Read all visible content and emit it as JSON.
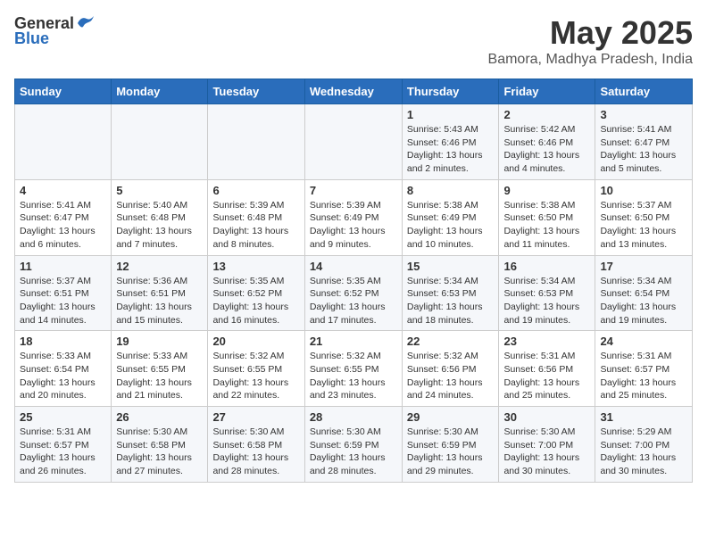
{
  "logo": {
    "general": "General",
    "blue": "Blue"
  },
  "header": {
    "title": "May 2025",
    "subtitle": "Bamora, Madhya Pradesh, India"
  },
  "weekdays": [
    "Sunday",
    "Monday",
    "Tuesday",
    "Wednesday",
    "Thursday",
    "Friday",
    "Saturday"
  ],
  "weeks": [
    [
      {
        "day": "",
        "info": ""
      },
      {
        "day": "",
        "info": ""
      },
      {
        "day": "",
        "info": ""
      },
      {
        "day": "",
        "info": ""
      },
      {
        "day": "1",
        "info": "Sunrise: 5:43 AM\nSunset: 6:46 PM\nDaylight: 13 hours\nand 2 minutes."
      },
      {
        "day": "2",
        "info": "Sunrise: 5:42 AM\nSunset: 6:46 PM\nDaylight: 13 hours\nand 4 minutes."
      },
      {
        "day": "3",
        "info": "Sunrise: 5:41 AM\nSunset: 6:47 PM\nDaylight: 13 hours\nand 5 minutes."
      }
    ],
    [
      {
        "day": "4",
        "info": "Sunrise: 5:41 AM\nSunset: 6:47 PM\nDaylight: 13 hours\nand 6 minutes."
      },
      {
        "day": "5",
        "info": "Sunrise: 5:40 AM\nSunset: 6:48 PM\nDaylight: 13 hours\nand 7 minutes."
      },
      {
        "day": "6",
        "info": "Sunrise: 5:39 AM\nSunset: 6:48 PM\nDaylight: 13 hours\nand 8 minutes."
      },
      {
        "day": "7",
        "info": "Sunrise: 5:39 AM\nSunset: 6:49 PM\nDaylight: 13 hours\nand 9 minutes."
      },
      {
        "day": "8",
        "info": "Sunrise: 5:38 AM\nSunset: 6:49 PM\nDaylight: 13 hours\nand 10 minutes."
      },
      {
        "day": "9",
        "info": "Sunrise: 5:38 AM\nSunset: 6:50 PM\nDaylight: 13 hours\nand 11 minutes."
      },
      {
        "day": "10",
        "info": "Sunrise: 5:37 AM\nSunset: 6:50 PM\nDaylight: 13 hours\nand 13 minutes."
      }
    ],
    [
      {
        "day": "11",
        "info": "Sunrise: 5:37 AM\nSunset: 6:51 PM\nDaylight: 13 hours\nand 14 minutes."
      },
      {
        "day": "12",
        "info": "Sunrise: 5:36 AM\nSunset: 6:51 PM\nDaylight: 13 hours\nand 15 minutes."
      },
      {
        "day": "13",
        "info": "Sunrise: 5:35 AM\nSunset: 6:52 PM\nDaylight: 13 hours\nand 16 minutes."
      },
      {
        "day": "14",
        "info": "Sunrise: 5:35 AM\nSunset: 6:52 PM\nDaylight: 13 hours\nand 17 minutes."
      },
      {
        "day": "15",
        "info": "Sunrise: 5:34 AM\nSunset: 6:53 PM\nDaylight: 13 hours\nand 18 minutes."
      },
      {
        "day": "16",
        "info": "Sunrise: 5:34 AM\nSunset: 6:53 PM\nDaylight: 13 hours\nand 19 minutes."
      },
      {
        "day": "17",
        "info": "Sunrise: 5:34 AM\nSunset: 6:54 PM\nDaylight: 13 hours\nand 19 minutes."
      }
    ],
    [
      {
        "day": "18",
        "info": "Sunrise: 5:33 AM\nSunset: 6:54 PM\nDaylight: 13 hours\nand 20 minutes."
      },
      {
        "day": "19",
        "info": "Sunrise: 5:33 AM\nSunset: 6:55 PM\nDaylight: 13 hours\nand 21 minutes."
      },
      {
        "day": "20",
        "info": "Sunrise: 5:32 AM\nSunset: 6:55 PM\nDaylight: 13 hours\nand 22 minutes."
      },
      {
        "day": "21",
        "info": "Sunrise: 5:32 AM\nSunset: 6:55 PM\nDaylight: 13 hours\nand 23 minutes."
      },
      {
        "day": "22",
        "info": "Sunrise: 5:32 AM\nSunset: 6:56 PM\nDaylight: 13 hours\nand 24 minutes."
      },
      {
        "day": "23",
        "info": "Sunrise: 5:31 AM\nSunset: 6:56 PM\nDaylight: 13 hours\nand 25 minutes."
      },
      {
        "day": "24",
        "info": "Sunrise: 5:31 AM\nSunset: 6:57 PM\nDaylight: 13 hours\nand 25 minutes."
      }
    ],
    [
      {
        "day": "25",
        "info": "Sunrise: 5:31 AM\nSunset: 6:57 PM\nDaylight: 13 hours\nand 26 minutes."
      },
      {
        "day": "26",
        "info": "Sunrise: 5:30 AM\nSunset: 6:58 PM\nDaylight: 13 hours\nand 27 minutes."
      },
      {
        "day": "27",
        "info": "Sunrise: 5:30 AM\nSunset: 6:58 PM\nDaylight: 13 hours\nand 28 minutes."
      },
      {
        "day": "28",
        "info": "Sunrise: 5:30 AM\nSunset: 6:59 PM\nDaylight: 13 hours\nand 28 minutes."
      },
      {
        "day": "29",
        "info": "Sunrise: 5:30 AM\nSunset: 6:59 PM\nDaylight: 13 hours\nand 29 minutes."
      },
      {
        "day": "30",
        "info": "Sunrise: 5:30 AM\nSunset: 7:00 PM\nDaylight: 13 hours\nand 30 minutes."
      },
      {
        "day": "31",
        "info": "Sunrise: 5:29 AM\nSunset: 7:00 PM\nDaylight: 13 hours\nand 30 minutes."
      }
    ]
  ]
}
